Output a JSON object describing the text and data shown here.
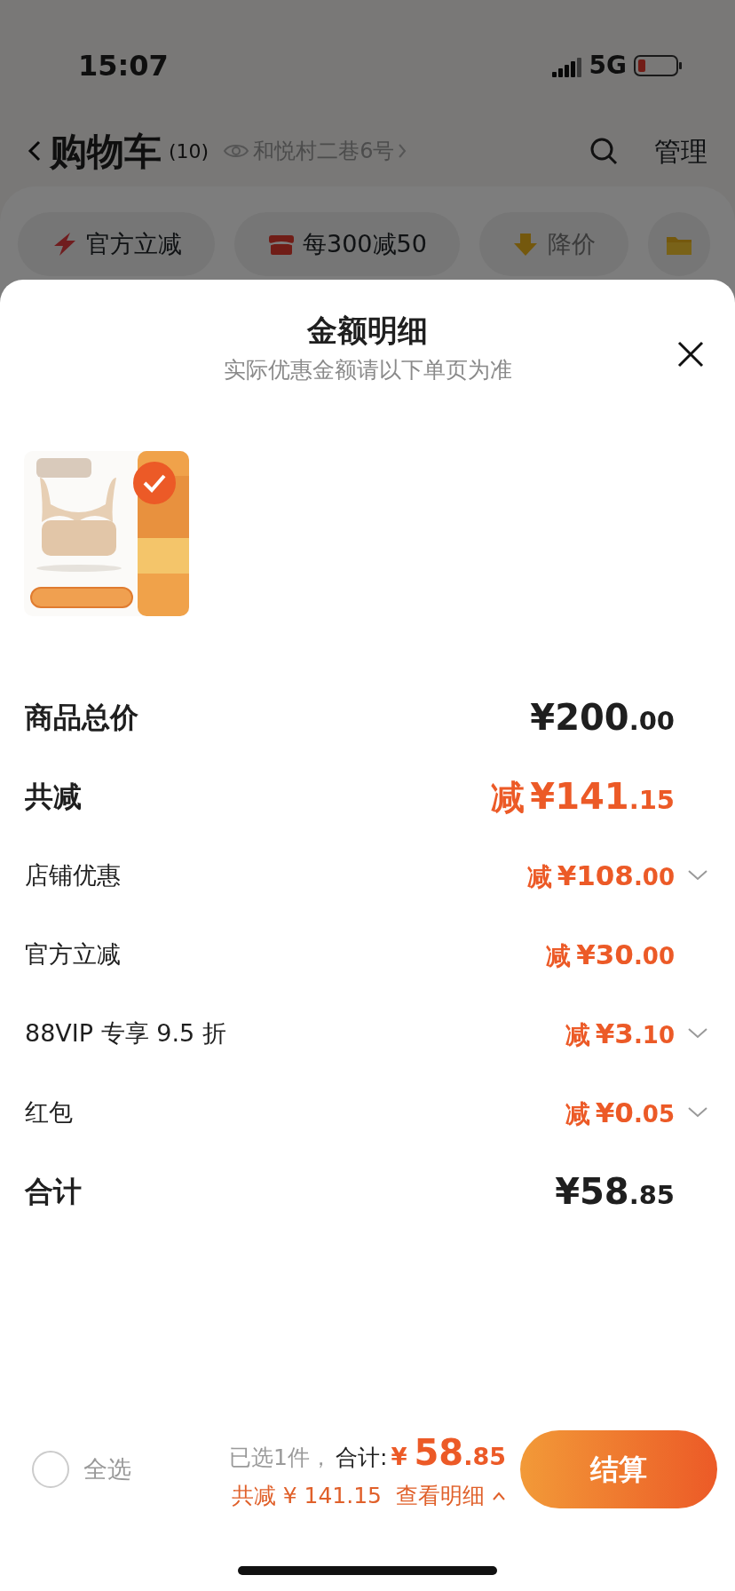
{
  "status_bar": {
    "time": "15:07",
    "network": "5G"
  },
  "header": {
    "title": "购物车",
    "count": "(10)",
    "address": "和悦村二巷6号",
    "action": "管理"
  },
  "promo_chips": [
    {
      "kind": "flash",
      "label": "官方立减"
    },
    {
      "kind": "shop",
      "label": "每300减50"
    },
    {
      "kind": "drop",
      "label": "降价"
    },
    {
      "kind": "folder"
    }
  ],
  "sheet": {
    "title": "金额明细",
    "subtitle": "实际优惠金额请以下单页为准",
    "items": [
      {
        "kind": "picture",
        "selected": true
      }
    ],
    "rows": [
      {
        "label": "商品总价",
        "kind": "major",
        "amount": "¥200.00",
        "discount": false,
        "expandable": false
      },
      {
        "label": "共减",
        "kind": "major",
        "prefix": "减",
        "amount": "¥141.15",
        "discount": true,
        "expandable": false
      },
      {
        "label": "店铺优惠",
        "kind": "minor",
        "prefix": "减",
        "amount": "¥108.00",
        "discount": true,
        "expandable": true
      },
      {
        "label": "官方立减",
        "kind": "minor",
        "prefix": "减",
        "amount": "¥30.00",
        "discount": true,
        "expandable": false
      },
      {
        "label": "88VIP 专享 9.5 折",
        "kind": "minor",
        "prefix": "减",
        "amount": "¥3.10",
        "discount": true,
        "expandable": true
      },
      {
        "label": "红包",
        "kind": "minor",
        "prefix": "减",
        "amount": "¥0.05",
        "discount": true,
        "expandable": true
      },
      {
        "label": "合计",
        "kind": "major",
        "amount": "¥58.85",
        "discount": false,
        "expandable": false
      }
    ]
  },
  "footer": {
    "select_all": {
      "label": "全选",
      "checked": false
    },
    "selected_count": "已选1件，",
    "total_label": "合计:",
    "total_currency": "¥",
    "total_amount": "58.85",
    "saved": "共减 ¥ 141.15",
    "details_link": "查看明细",
    "details_expanded": true,
    "checkout": "结算"
  }
}
